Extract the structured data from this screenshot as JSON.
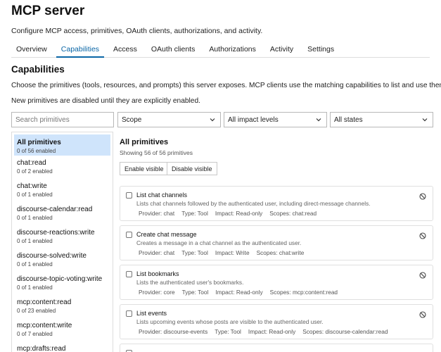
{
  "header": {
    "title": "MCP server",
    "description": "Configure MCP access, primitives, OAuth clients, authorizations, and activity."
  },
  "tabs": [
    {
      "label": "Overview",
      "active": false
    },
    {
      "label": "Capabilities",
      "active": true
    },
    {
      "label": "Access",
      "active": false
    },
    {
      "label": "OAuth clients",
      "active": false
    },
    {
      "label": "Authorizations",
      "active": false
    },
    {
      "label": "Activity",
      "active": false
    },
    {
      "label": "Settings",
      "active": false
    }
  ],
  "capabilities": {
    "title": "Capabilities",
    "description": "Choose the primitives (tools, resources, and prompts) this server exposes. MCP clients use the matching capabilities to list and use them.",
    "note": "New primitives are disabled until they are explicitly enabled."
  },
  "filters": {
    "search_placeholder": "Search primitives",
    "scope": "Scope",
    "impact": "All impact levels",
    "state": "All states"
  },
  "sidebar": {
    "items": [
      {
        "name": "All primitives",
        "count": "0 of 56 enabled",
        "active": true
      },
      {
        "name": "chat:read",
        "count": "0 of 2 enabled"
      },
      {
        "name": "chat:write",
        "count": "0 of 1 enabled"
      },
      {
        "name": "discourse-calendar:read",
        "count": "0 of 1 enabled"
      },
      {
        "name": "discourse-reactions:write",
        "count": "0 of 1 enabled"
      },
      {
        "name": "discourse-solved:write",
        "count": "0 of 1 enabled"
      },
      {
        "name": "discourse-topic-voting:write",
        "count": "0 of 1 enabled"
      },
      {
        "name": "mcp:content:read",
        "count": "0 of 23 enabled"
      },
      {
        "name": "mcp:content:write",
        "count": "0 of 7 enabled"
      },
      {
        "name": "mcp:drafts:read",
        "count": ""
      }
    ]
  },
  "main": {
    "title": "All primitives",
    "count": "Showing 56 of 56 primitives",
    "enable_label": "Enable visible",
    "disable_label": "Disable visible",
    "primitives": [
      {
        "name": "List chat channels",
        "description": "Lists chat channels followed by the authenticated user, including direct-message channels.",
        "provider": "Provider: chat",
        "type": "Type: Tool",
        "impact": "Impact: Read-only",
        "scopes": "Scopes: chat:read"
      },
      {
        "name": "Create chat message",
        "description": "Creates a message in a chat channel as the authenticated user.",
        "provider": "Provider: chat",
        "type": "Type: Tool",
        "impact": "Impact: Write",
        "scopes": "Scopes: chat:write"
      },
      {
        "name": "List bookmarks",
        "description": "Lists the authenticated user's bookmarks.",
        "provider": "Provider: core",
        "type": "Type: Tool",
        "impact": "Impact: Read-only",
        "scopes": "Scopes: mcp:content:read"
      },
      {
        "name": "List events",
        "description": "Lists upcoming events whose posts are visible to the authenticated user.",
        "provider": "Provider: discourse-events",
        "type": "Type: Tool",
        "impact": "Impact: Read-only",
        "scopes": "Scopes: discourse-calendar:read"
      }
    ]
  }
}
